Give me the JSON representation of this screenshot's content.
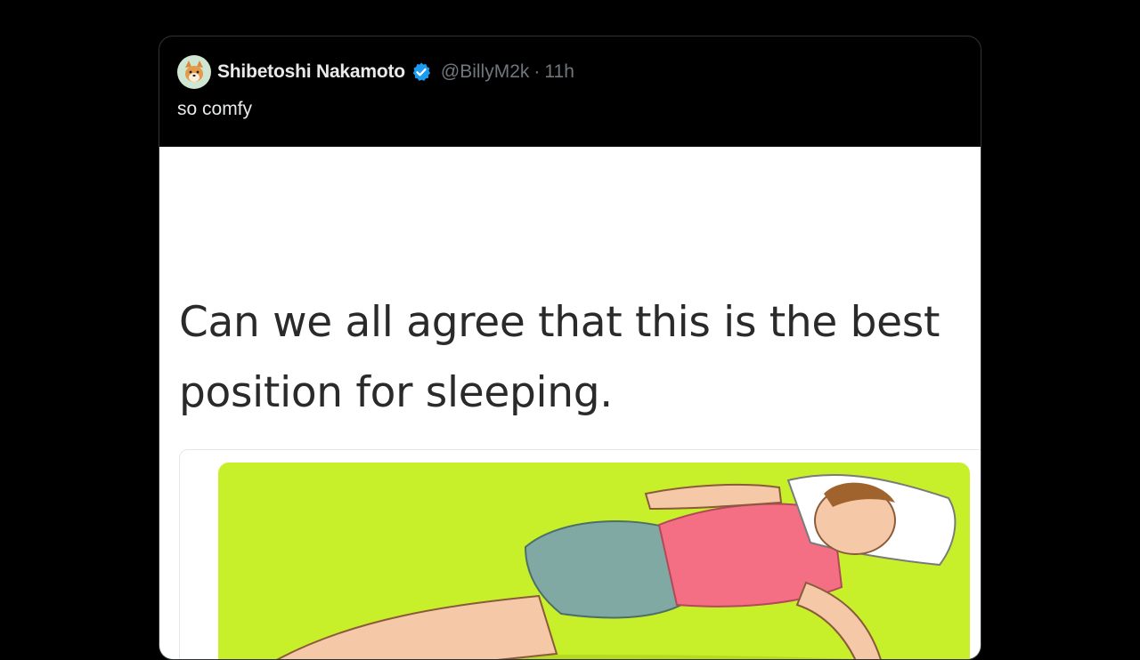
{
  "author": {
    "display_name": "Shibetoshi Nakamoto",
    "handle": "@BillyM2k",
    "separator": "·",
    "time": "11h",
    "avatar_icon": "shiba-avatar-icon",
    "verified_icon": "verified-badge-icon",
    "verified_color": "#1d9bf0"
  },
  "tweet": {
    "text": "so comfy"
  },
  "media": {
    "caption": "Can we all agree that this is the best position for sleeping.",
    "illustration_background": "#c8f02a"
  },
  "colors": {
    "background": "#000000",
    "text_primary": "#e7e9ea",
    "text_secondary": "#71767b"
  }
}
